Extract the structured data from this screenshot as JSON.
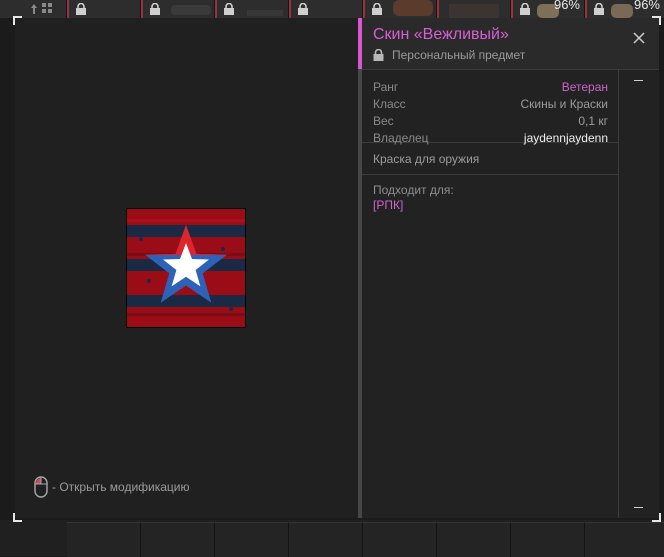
{
  "inventory_top": [
    {
      "type": "grid"
    },
    {
      "type": "locked"
    },
    {
      "type": "locked"
    },
    {
      "type": "locked"
    },
    {
      "type": "locked"
    },
    {
      "type": "locked"
    },
    {
      "type": "locked"
    },
    {
      "type": "locked",
      "percent": "96%"
    },
    {
      "type": "locked",
      "percent": "96%"
    }
  ],
  "item": {
    "title": "Скин «Вежливый»",
    "subtitle": "Персональный предмет",
    "stats": [
      {
        "label": "Ранг",
        "value": "Ветеран"
      },
      {
        "label": "Класс",
        "value": "Скины и Краски"
      },
      {
        "label": "Вес",
        "value": "0,1 кг"
      },
      {
        "label": "Владелец",
        "value": "jaydennjaydenn"
      }
    ],
    "description": "Краска для оружия",
    "compatible_title": "Подходит для:",
    "compatible_value": "[РПК]"
  },
  "hint": {
    "text": "- Открыть модификацию",
    "icon": "mouse-icon"
  },
  "icons": {
    "close": "close-icon",
    "lock": "lock-icon",
    "scroll_up": "scroll-up-icon",
    "scroll_down": "scroll-down-icon"
  },
  "colors": {
    "accent": "#d957d2",
    "rank": "#cc66c7",
    "owner": "#f0f0f0",
    "star_red": "#e0242b",
    "star_blue": "#2d62b8",
    "star_white": "#ffffff",
    "background_red": "#9b0d16",
    "background_navy": "#1b2a44"
  }
}
